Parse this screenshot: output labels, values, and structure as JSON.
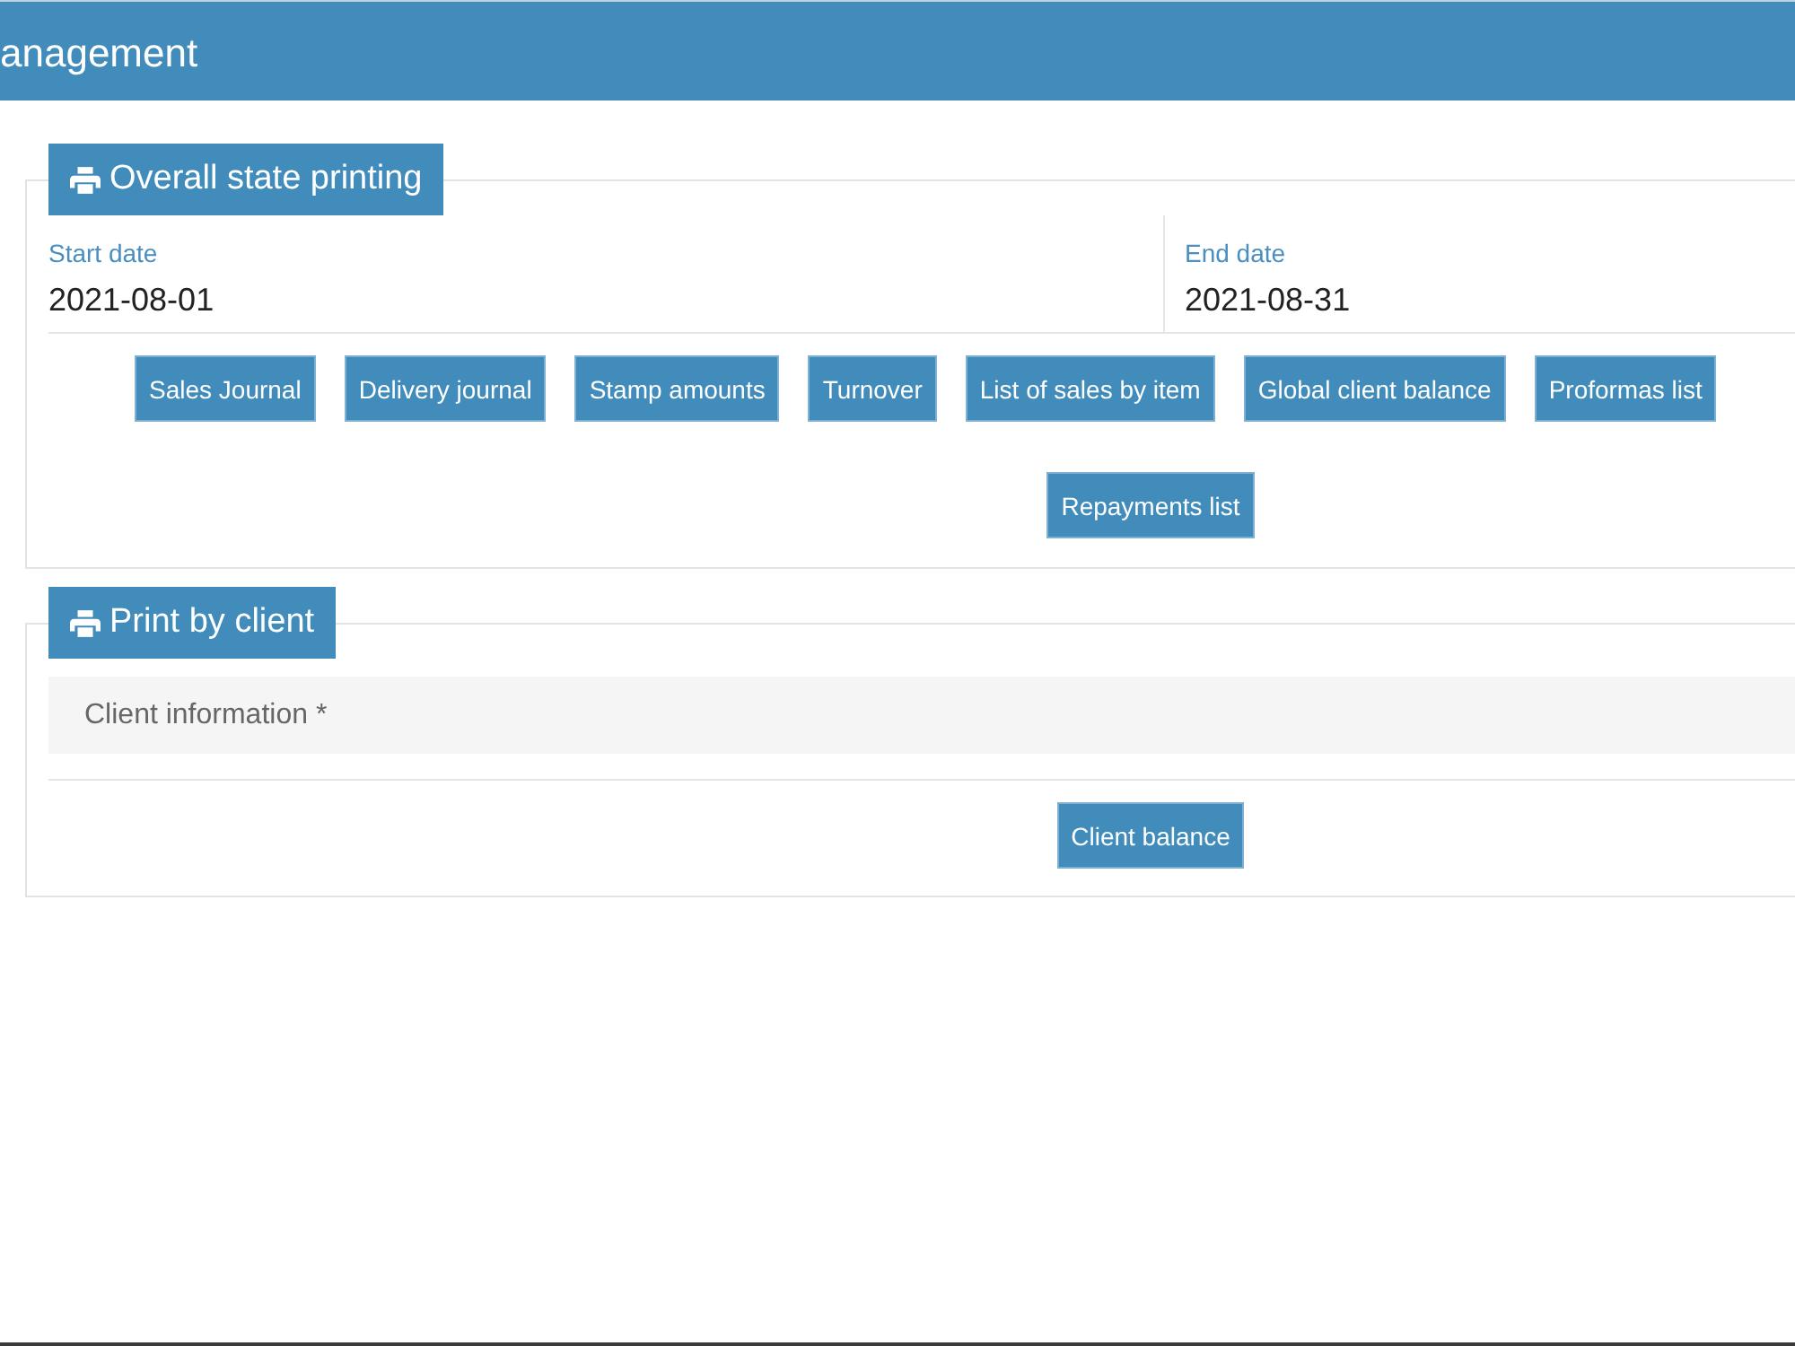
{
  "header": {
    "title": "anagement"
  },
  "sections": [
    {
      "kind": "date-range",
      "title": "Overall state printing",
      "fields": [
        {
          "label": "Start date",
          "value": "2021-08-01"
        },
        {
          "label": "End date",
          "value": "2021-08-31"
        }
      ],
      "button_rows": [
        [
          "Sales Journal",
          "Delivery journal",
          "Stamp amounts",
          "Turnover",
          "List of sales by item",
          "Global client balance",
          "Proformas list"
        ],
        [
          "Repayments list"
        ]
      ]
    },
    {
      "kind": "client",
      "title": "Print by client",
      "client_field": {
        "placeholder": "Client information *"
      },
      "button_rows": [
        [
          "Client balance"
        ]
      ]
    }
  ]
}
